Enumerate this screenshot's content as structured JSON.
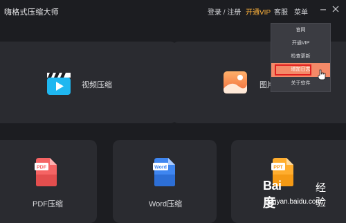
{
  "app": {
    "title": "嗨格式压缩大师"
  },
  "topnav": {
    "login": "登录 / 注册",
    "vip": "开通VIP",
    "service": "客服",
    "menu": "菜单",
    "minimize_icon": "minimize-icon",
    "close_icon": "close-icon"
  },
  "cards": {
    "video": {
      "label": "视频压缩",
      "icon": "video-clapper-icon"
    },
    "image": {
      "label": "图片",
      "icon": "image-icon"
    },
    "pdf": {
      "label": "PDF压缩",
      "badge": "PDF",
      "icon": "pdf-file-icon"
    },
    "word": {
      "label": "Word压缩",
      "badge": "Word",
      "icon": "word-file-icon"
    },
    "ppt": {
      "badge": "PPT",
      "icon": "ppt-file-icon"
    }
  },
  "dropdown": {
    "items": [
      "官网",
      "开通VIP",
      "检查更新",
      "增加日志",
      "关于软件"
    ],
    "active_index": 3
  },
  "watermark": {
    "logo": "Bai度",
    "jingyan": "经验",
    "url": "jingyan.baidu.com"
  },
  "colors": {
    "accent_vip": "#ffb33c",
    "menu_active": "#f48a68",
    "highlight_border": "#e02020",
    "background": "#1c1d21",
    "card": "#2a2b30"
  }
}
